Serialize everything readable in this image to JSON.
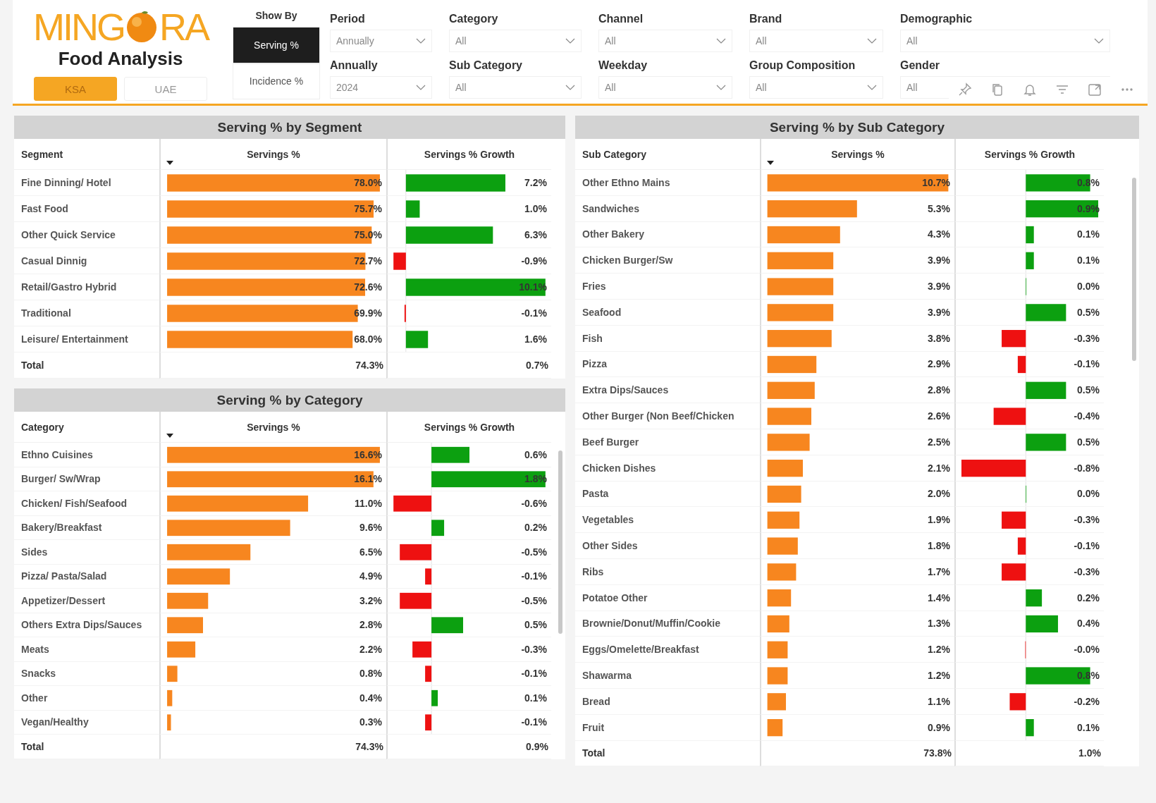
{
  "logo": {
    "before": "MING",
    "after": "RA",
    "subtitle": "Food Analysis"
  },
  "countries": [
    {
      "label": "KSA",
      "selected": true
    },
    {
      "label": "UAE",
      "selected": false
    }
  ],
  "show_by": {
    "label": "Show By",
    "options": [
      {
        "label": "Serving %",
        "selected": true
      },
      {
        "label": "Incidence %",
        "selected": false
      }
    ]
  },
  "filters": [
    {
      "label": "Period",
      "value": "Annually"
    },
    {
      "label": "Category",
      "value": "All"
    },
    {
      "label": "Channel",
      "value": "All"
    },
    {
      "label": "Brand",
      "value": "All"
    },
    {
      "label": "Demographic",
      "value": "All"
    },
    {
      "label": "Annually",
      "value": "2024"
    },
    {
      "label": "Sub Category",
      "value": "All"
    },
    {
      "label": "Weekday",
      "value": "All"
    },
    {
      "label": "Group Composition",
      "value": "All"
    },
    {
      "label": "Gender",
      "value": "All"
    }
  ],
  "segment_table": {
    "title": "Serving % by Segment",
    "columns": [
      {
        "label": "Segment",
        "sorted": false
      },
      {
        "label": "Servings %",
        "sorted": true
      },
      {
        "label": "Servings % Growth",
        "sorted": false
      }
    ],
    "rows": [
      {
        "name": "Fine Dinning/ Hotel",
        "servings": "78.0%",
        "growth": "7.2%"
      },
      {
        "name": "Fast Food",
        "servings": "75.7%",
        "growth": "1.0%"
      },
      {
        "name": "Other Quick Service",
        "servings": "75.0%",
        "growth": "6.3%"
      },
      {
        "name": "Casual Dinnig",
        "servings": "72.7%",
        "growth": "-0.9%"
      },
      {
        "name": "Retail/Gastro Hybrid",
        "servings": "72.6%",
        "growth": "10.1%"
      },
      {
        "name": "Traditional",
        "servings": "69.9%",
        "growth": "-0.1%"
      },
      {
        "name": "Leisure/ Entertainment",
        "servings": "68.0%",
        "growth": "1.6%"
      }
    ],
    "total": {
      "name": "Total",
      "servings": "74.3%",
      "growth": "0.7%"
    }
  },
  "category_table": {
    "title": "Serving % by Category",
    "columns": [
      {
        "label": "Category",
        "sorted": false
      },
      {
        "label": "Servings %",
        "sorted": true
      },
      {
        "label": "Servings % Growth",
        "sorted": false
      }
    ],
    "rows": [
      {
        "name": "Ethno Cuisines",
        "servings": "16.6%",
        "growth": "0.6%"
      },
      {
        "name": "Burger/ Sw/Wrap",
        "servings": "16.1%",
        "growth": "1.8%"
      },
      {
        "name": "Chicken/ Fish/Seafood",
        "servings": "11.0%",
        "growth": "-0.6%"
      },
      {
        "name": "Bakery/Breakfast",
        "servings": "9.6%",
        "growth": "0.2%"
      },
      {
        "name": "Sides",
        "servings": "6.5%",
        "growth": "-0.5%"
      },
      {
        "name": "Pizza/ Pasta/Salad",
        "servings": "4.9%",
        "growth": "-0.1%"
      },
      {
        "name": "Appetizer/Dessert",
        "servings": "3.2%",
        "growth": "-0.5%"
      },
      {
        "name": "Others Extra Dips/Sauces",
        "servings": "2.8%",
        "growth": "0.5%"
      },
      {
        "name": "Meats",
        "servings": "2.2%",
        "growth": "-0.3%"
      },
      {
        "name": "Snacks",
        "servings": "0.8%",
        "growth": "-0.1%"
      },
      {
        "name": "Other",
        "servings": "0.4%",
        "growth": "0.1%"
      },
      {
        "name": "Vegan/Healthy",
        "servings": "0.3%",
        "growth": "-0.1%"
      }
    ],
    "total": {
      "name": "Total",
      "servings": "74.3%",
      "growth": "0.9%"
    }
  },
  "subcategory_table": {
    "title": "Serving % by Sub Category",
    "columns": [
      {
        "label": "Sub Category",
        "sorted": false
      },
      {
        "label": "Servings %",
        "sorted": true
      },
      {
        "label": "Servings % Growth",
        "sorted": false
      }
    ],
    "rows": [
      {
        "name": "Other Ethno Mains",
        "servings": "10.7%",
        "growth": "0.8%"
      },
      {
        "name": "Sandwiches",
        "servings": "5.3%",
        "growth": "0.9%"
      },
      {
        "name": "Other Bakery",
        "servings": "4.3%",
        "growth": "0.1%"
      },
      {
        "name": "Chicken Burger/Sw",
        "servings": "3.9%",
        "growth": "0.1%"
      },
      {
        "name": "Fries",
        "servings": "3.9%",
        "growth": "0.0%"
      },
      {
        "name": "Seafood",
        "servings": "3.9%",
        "growth": "0.5%"
      },
      {
        "name": "Fish",
        "servings": "3.8%",
        "growth": "-0.3%"
      },
      {
        "name": "Pizza",
        "servings": "2.9%",
        "growth": "-0.1%"
      },
      {
        "name": "Extra Dips/Sauces",
        "servings": "2.8%",
        "growth": "0.5%"
      },
      {
        "name": "Other Burger (Non Beef/Chicken",
        "servings": "2.6%",
        "growth": "-0.4%"
      },
      {
        "name": "Beef Burger",
        "servings": "2.5%",
        "growth": "0.5%"
      },
      {
        "name": "Chicken Dishes",
        "servings": "2.1%",
        "growth": "-0.8%"
      },
      {
        "name": "Pasta",
        "servings": "2.0%",
        "growth": "0.0%"
      },
      {
        "name": "Vegetables",
        "servings": "1.9%",
        "growth": "-0.3%"
      },
      {
        "name": "Other Sides",
        "servings": "1.8%",
        "growth": "-0.1%"
      },
      {
        "name": "Ribs",
        "servings": "1.7%",
        "growth": "-0.3%"
      },
      {
        "name": "Potatoe Other",
        "servings": "1.4%",
        "growth": "0.2%"
      },
      {
        "name": "Brownie/Donut/Muffin/Cookie",
        "servings": "1.3%",
        "growth": "0.4%"
      },
      {
        "name": "Eggs/Omelette/Breakfast",
        "servings": "1.2%",
        "growth": "-0.0%"
      },
      {
        "name": "Shawarma",
        "servings": "1.2%",
        "growth": "0.8%"
      },
      {
        "name": "Bread",
        "servings": "1.1%",
        "growth": "-0.2%"
      },
      {
        "name": "Fruit",
        "servings": "0.9%",
        "growth": "0.1%"
      }
    ],
    "total": {
      "name": "Total",
      "servings": "73.8%",
      "growth": "1.0%"
    }
  }
}
